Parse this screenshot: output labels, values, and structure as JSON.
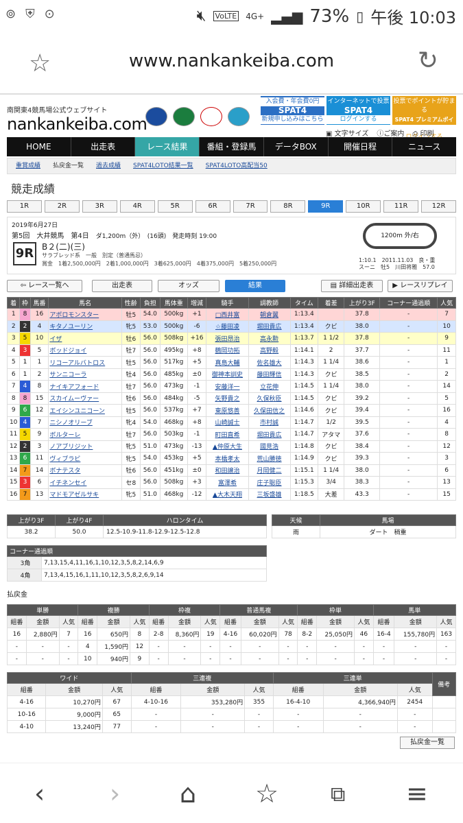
{
  "status": {
    "icons_left": [
      "ON",
      "ON"
    ],
    "battery": "73%",
    "time": "午後 10:03",
    "network": "4G+",
    "volte": "VoLTE"
  },
  "browser": {
    "url": "www.nankankeiba.com"
  },
  "site": {
    "tagline": "南関東4競馬場公式ウェブサイト",
    "brand": "nankankeiba.com"
  },
  "spat": [
    {
      "line1": "入会費・年会費0円",
      "line2": "SPAT4",
      "line3": "新規申し込みはこちら",
      "color": "#2b6fc4"
    },
    {
      "line1": "インターネットで投票",
      "line2": "SPAT4",
      "line3": "ログインする",
      "color": "#1a8fd6"
    },
    {
      "line1": "投票でポイントが貯まる",
      "line2": "SPAT4 プレミアムポイント",
      "line3": "ログインする",
      "color": "#e8a31a"
    }
  ],
  "tools": {
    "font": "文字サイズ",
    "guide": "ご案内",
    "print": "印刷"
  },
  "mainnav": [
    "HOME",
    "出走表",
    "レース結果",
    "番組・登録馬",
    "データBOX",
    "開催日程",
    "ニュース"
  ],
  "subnav": [
    "重賞成績",
    "払戻金一覧",
    "過去成績",
    "SPAT4LOTO結果一覧",
    "SPAT4LOTO高配当50"
  ],
  "section_title": "競走成績",
  "race_tabs": [
    "1R",
    "2R",
    "3R",
    "4R",
    "5R",
    "6R",
    "7R",
    "8R",
    "9R",
    "10R",
    "11R",
    "12R"
  ],
  "race": {
    "date": "2019年6月27日",
    "meeting": "第5回　大井競馬　第4日",
    "distance": "ダ1,200m（外）　(16頭)　発走時刻 19:00",
    "number": "9R",
    "class": "B２(二)(三)",
    "conditions": "サラブレッド系　一般　別定（普通馬忌）",
    "prize": "賞金　1着2,500,000円　2着1,000,000円　3着625,000円　4着375,000円　5着250,000円",
    "track": "1200m  外/右",
    "track_sub": "0",
    "record_time": "1:10.1　2011.11.03　良・重",
    "record_horse": "スーニ　牡5　川田将雅　57.0"
  },
  "buttons": {
    "back": "レース一覧へ",
    "entries": "出走表",
    "odds": "オッズ",
    "results": "結果",
    "detail": "詳細出走表",
    "replay": "レースリプレイ"
  },
  "results": {
    "headers": [
      "着",
      "枠",
      "馬番",
      "馬名",
      "性齢",
      "負担",
      "馬体重",
      "増減",
      "騎手",
      "調教師",
      "タイム",
      "着差",
      "上がり3F",
      "コーナー通過順",
      "人気"
    ],
    "rows": [
      [
        "1",
        "8",
        "16",
        "アポロモンスター",
        "牡5",
        "54.0",
        "500kg",
        "+1",
        "□西井富",
        "朝倉翼",
        "1:13.4",
        "",
        "37.8",
        "-",
        "7"
      ],
      [
        "2",
        "2",
        "4",
        "キタノユーリン",
        "牝5",
        "53.0",
        "500kg",
        "-6",
        "☆藤田凌",
        "堀田貴広",
        "1:13.4",
        "クビ",
        "38.0",
        "-",
        "10"
      ],
      [
        "3",
        "5",
        "10",
        "イザ",
        "牡6",
        "56.0",
        "508kg",
        "+16",
        "張田昂治",
        "高永勲",
        "1:13.7",
        "1 1/2",
        "37.8",
        "-",
        "9"
      ],
      [
        "4",
        "3",
        "5",
        "ボッドジョイ",
        "牡7",
        "56.0",
        "495kg",
        "+8",
        "鶴岡功拓",
        "高野毅",
        "1:14.1",
        "2",
        "37.7",
        "-",
        "11"
      ],
      [
        "5",
        "1",
        "1",
        "リコーアルバトロス",
        "牡5",
        "56.0",
        "517kg",
        "+5",
        "真島大輔",
        "佐名雄大",
        "1:14.3",
        "1 1/4",
        "38.6",
        "-",
        "1"
      ],
      [
        "6",
        "1",
        "2",
        "サンニコーラ",
        "牡4",
        "56.0",
        "485kg",
        "±0",
        "御神本訓史",
        "藤田輝信",
        "1:14.3",
        "クビ",
        "38.5",
        "-",
        "2"
      ],
      [
        "7",
        "4",
        "8",
        "ナイキアフォード",
        "牡7",
        "56.0",
        "473kg",
        "-1",
        "安藤洋一",
        "立花伸",
        "1:14.5",
        "1 1/4",
        "38.0",
        "-",
        "14"
      ],
      [
        "8",
        "8",
        "15",
        "スカイムーヴァー",
        "牡6",
        "56.0",
        "484kg",
        "-5",
        "矢野貴之",
        "久保秋臣",
        "1:14.5",
        "クビ",
        "39.2",
        "-",
        "5"
      ],
      [
        "9",
        "6",
        "12",
        "エイシンユニコーン",
        "牡5",
        "56.0",
        "537kg",
        "+7",
        "東原悠善",
        "久保田信之",
        "1:14.6",
        "クビ",
        "39.4",
        "-",
        "16"
      ],
      [
        "10",
        "4",
        "7",
        "ニシノオリーブ",
        "牝4",
        "54.0",
        "468kg",
        "+8",
        "山崎誠士",
        "市村誠",
        "1:14.7",
        "1/2",
        "39.5",
        "-",
        "4"
      ],
      [
        "11",
        "5",
        "9",
        "ボルターレ",
        "牡7",
        "56.0",
        "503kg",
        "-1",
        "町田直希",
        "堀田貴広",
        "1:14.7",
        "アタマ",
        "37.6",
        "-",
        "8"
      ],
      [
        "12",
        "2",
        "3",
        "ノアブリジット",
        "牝5",
        "51.0",
        "473kg",
        "-13",
        "▲仲原大生",
        "國見浩",
        "1:14.8",
        "クビ",
        "38.4",
        "-",
        "12"
      ],
      [
        "13",
        "6",
        "11",
        "ヴィブラビ",
        "牝5",
        "54.0",
        "453kg",
        "+5",
        "本橋孝太",
        "荒山勝徳",
        "1:14.9",
        "クビ",
        "39.3",
        "-",
        "3"
      ],
      [
        "14",
        "7",
        "14",
        "ボナテスタ",
        "牡6",
        "56.0",
        "451kg",
        "±0",
        "和田譲治",
        "月岡健二",
        "1:15.1",
        "1 1/4",
        "38.0",
        "-",
        "6"
      ],
      [
        "15",
        "3",
        "6",
        "イチネンセイ",
        "セ8",
        "56.0",
        "508kg",
        "+3",
        "富澤希",
        "庄子聡臣",
        "1:15.3",
        "3/4",
        "38.3",
        "-",
        "13"
      ],
      [
        "16",
        "7",
        "13",
        "マドモアゼルサキ",
        "牝5",
        "51.0",
        "468kg",
        "-12",
        "▲大木天翔",
        "三坂盛雄",
        "1:18.5",
        "大差",
        "43.3",
        "-",
        "15"
      ]
    ]
  },
  "splits": {
    "headers": [
      "上がり3F",
      "上がり4F",
      "ハロンタイム"
    ],
    "values": [
      "38.2",
      "50.0",
      "12.5-10.9-11.8-12.9-12.5-12.8"
    ]
  },
  "weather": {
    "headers": [
      "天候",
      "馬場"
    ],
    "values": [
      "雨",
      "ダート　稍重"
    ]
  },
  "corners": {
    "title": "コーナー通過順",
    "rows": [
      [
        "3角",
        "7,13,15,4,11,16,1,10,12,3,5,8,2,14,6,9"
      ],
      [
        "4角",
        "7,13,4,15,16,1,11,10,12,3,5,8,2,6,9,14"
      ]
    ]
  },
  "payout_title": "払戻金",
  "payout1": {
    "groups": [
      "単勝",
      "複勝",
      "枠複",
      "普通馬複",
      "枠単",
      "馬単"
    ],
    "sub": [
      "組番",
      "金額",
      "人気"
    ],
    "rows": [
      [
        "16",
        "2,880円",
        "7",
        "16",
        "650円",
        "8",
        "2-8",
        "8,360円",
        "19",
        "4-16",
        "60,020円",
        "78",
        "8-2",
        "25,050円",
        "46",
        "16-4",
        "155,780円",
        "163"
      ],
      [
        "-",
        "-",
        "-",
        "4",
        "1,590円",
        "12",
        "-",
        "-",
        "-",
        "-",
        "-",
        "-",
        "-",
        "-",
        "-",
        "-",
        "-",
        "-"
      ],
      [
        "-",
        "-",
        "-",
        "10",
        "940円",
        "9",
        "-",
        "-",
        "-",
        "-",
        "-",
        "-",
        "-",
        "-",
        "-",
        "-",
        "-",
        "-"
      ]
    ]
  },
  "payout2": {
    "groups": [
      "ワイド",
      "三連複",
      "三連単",
      "備考"
    ],
    "sub": [
      "組番",
      "金額",
      "人気"
    ],
    "rows": [
      [
        "4-16",
        "10,270円",
        "67",
        "4-10-16",
        "353,280円",
        "355",
        "16-4-10",
        "4,366,940円",
        "2454",
        ""
      ],
      [
        "10-16",
        "9,000円",
        "65",
        "-",
        "-",
        "-",
        "-",
        "-",
        "-",
        ""
      ],
      [
        "4-10",
        "13,240円",
        "77",
        "-",
        "-",
        "-",
        "-",
        "-",
        "-",
        ""
      ]
    ]
  },
  "payout_list_button": "払戻金一覧",
  "colors": {
    "accent": "#35a6a6",
    "blue": "#2a7fd6",
    "header": "#555555"
  }
}
